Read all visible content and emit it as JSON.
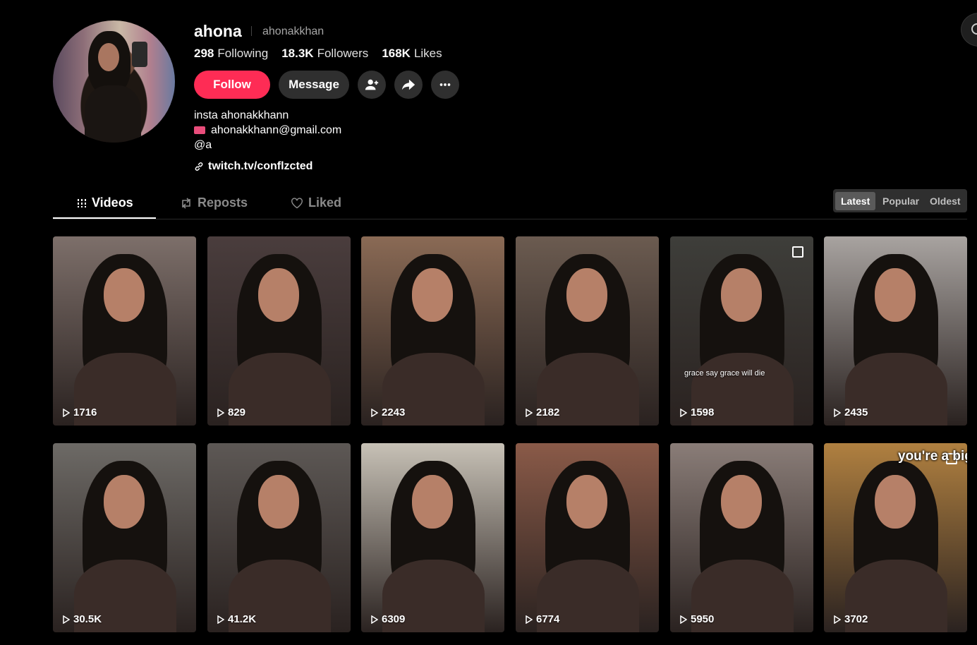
{
  "profile": {
    "username": "ahona",
    "handle": "ahonakkhan",
    "stats": [
      {
        "value": "298",
        "label": "Following"
      },
      {
        "value": "18.3K",
        "label": "Followers"
      },
      {
        "value": "168K",
        "label": "Likes"
      }
    ],
    "buttons": {
      "follow": "Follow",
      "message": "Message"
    },
    "bio": [
      "insta ahonakkhann",
      "ahonakkhann@gmail.com",
      "@a"
    ],
    "link": "twitch.tv/conflzcted"
  },
  "tabs": [
    {
      "label": "Videos",
      "active": true,
      "icon": "grid-icon"
    },
    {
      "label": "Reposts",
      "active": false,
      "icon": "repost-icon"
    },
    {
      "label": "Liked",
      "active": false,
      "icon": "heart-icon"
    }
  ],
  "sort": [
    "Latest",
    "Popular",
    "Oldest"
  ],
  "videos": [
    {
      "views": "1716",
      "bg": "#7d6f6a"
    },
    {
      "views": "829",
      "bg": "#4a3d3d"
    },
    {
      "views": "2243",
      "bg": "#8a6a55"
    },
    {
      "views": "2182",
      "bg": "#6b5b50"
    },
    {
      "views": "1598",
      "bg": "#3e3e3a",
      "caption": "grace say grace will die",
      "multi": true
    },
    {
      "views": "2435",
      "bg": "#a8a3a0"
    },
    {
      "views": "30.5K",
      "bg": "#6d6a66"
    },
    {
      "views": "41.2K",
      "bg": "#5d5855"
    },
    {
      "views": "6309",
      "bg": "#c7c1b6"
    },
    {
      "views": "6774",
      "bg": "#8a5a48"
    },
    {
      "views": "5950",
      "bg": "#8a7d78"
    },
    {
      "views": "3702",
      "bg": "#b08040",
      "caption": "you're a big",
      "multi": true
    }
  ]
}
